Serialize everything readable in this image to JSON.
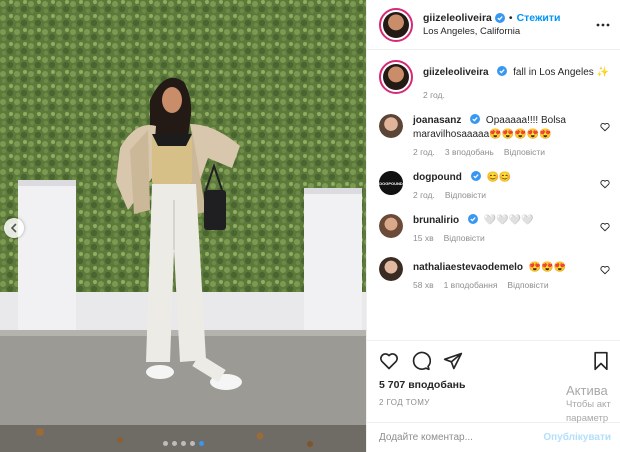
{
  "photo": {
    "prev_icon": "chevron-left-icon",
    "carousel_dots": 5,
    "active_dot": 4
  },
  "header": {
    "username": "giizeleoliveira",
    "verified_icon": "verified-badge-icon",
    "separator": "•",
    "follow": "Стежити",
    "location": "Los Angeles, California",
    "more_icon": "more-options-icon"
  },
  "caption": {
    "username": "giizeleoliveira",
    "text": "fall in Los Angeles ✨",
    "time": "2 год."
  },
  "comments": [
    {
      "username": "joanasanz",
      "text": "Opaaaaa!!!! Bolsa maravilhosaaaaa😍😍😍😍😍",
      "time": "2 год.",
      "likes": "3 вподобань",
      "reply": "Відповісти",
      "verified": true
    },
    {
      "username": "dogpound",
      "text": "😊😊",
      "time": "2 год.",
      "likes": "",
      "reply": "Відповісти",
      "verified": true
    },
    {
      "username": "brunalirio",
      "text": "🤍🤍🤍🤍",
      "time": "15 хв",
      "likes": "",
      "reply": "Відповісти",
      "verified": true
    },
    {
      "username": "nathaliaestevaodemelo",
      "text": "😍😍😍",
      "time": "58 хв",
      "likes": "1 вподобання",
      "reply": "Відповісти",
      "verified": false
    }
  ],
  "actions": {
    "like_icon": "heart-icon",
    "comment_icon": "comment-icon",
    "share_icon": "share-icon",
    "save_icon": "bookmark-icon",
    "likes_count": "5 707 вподобань",
    "time_ago": "2 ГОД ТОМУ"
  },
  "add_comment": {
    "placeholder": "Додайте коментар...",
    "publish": "Опублікувати"
  },
  "watermark": {
    "line1": "Актива",
    "line2": "Чтобы акт",
    "line3": "параметр"
  },
  "colors": {
    "accent": "#0095f6",
    "verified": "#3897f0",
    "story_ring": "#d62976",
    "muted": "#8e8e8e"
  }
}
